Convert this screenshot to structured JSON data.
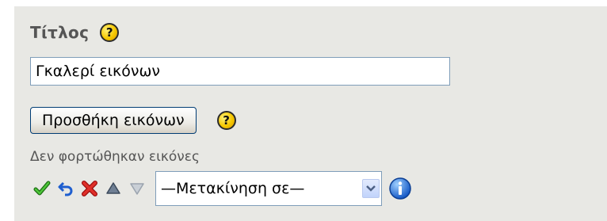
{
  "title_field": {
    "label": "Τίτλος",
    "value": "Γκαλερί εικόνων"
  },
  "help_icon": {
    "glyph": "?",
    "color": "#f6c800"
  },
  "add_images": {
    "button_label": "Προσθήκη εικόνων"
  },
  "status": {
    "text": "Δεν φορτώθηκαν εικόνες"
  },
  "toolbar": {
    "tools": [
      "check-icon",
      "undo-icon",
      "delete-icon",
      "move-up-icon",
      "move-down-icon"
    ],
    "move_select": {
      "selected": "—Μετακίνηση σε—"
    },
    "info_icon": "info-icon"
  }
}
